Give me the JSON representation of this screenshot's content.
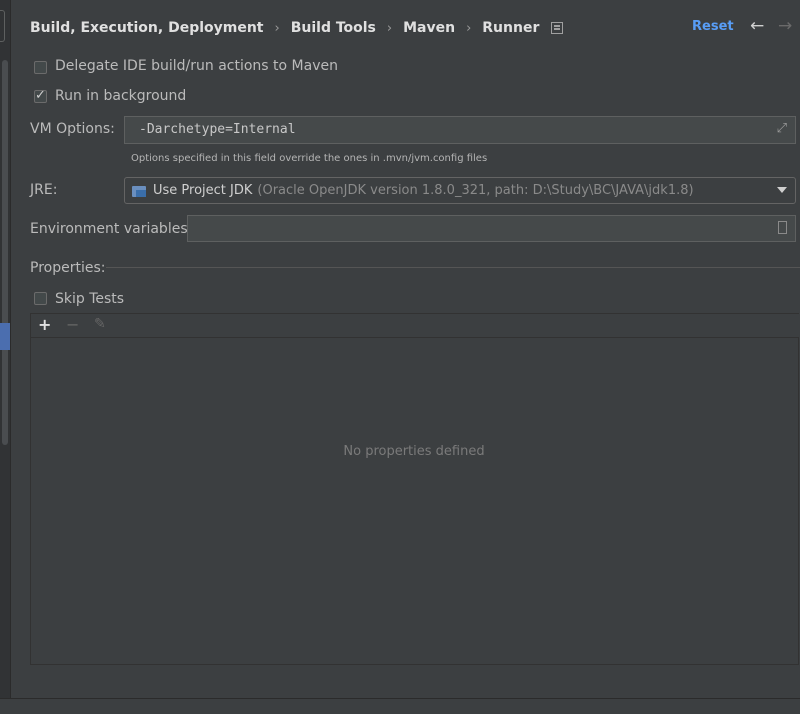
{
  "breadcrumb": {
    "items": [
      "Build, Execution, Deployment",
      "Build Tools",
      "Maven",
      "Runner"
    ],
    "separator": "›"
  },
  "header": {
    "reset_label": "Reset",
    "back_icon": "arrow-left-icon",
    "forward_icon": "arrow-right-icon"
  },
  "options": {
    "delegate": {
      "label": "Delegate IDE build/run actions to Maven",
      "checked": false
    },
    "background": {
      "label": "Run in background",
      "checked": true
    }
  },
  "vm_options": {
    "label": "VM Options:",
    "value": "-Darchetype=Internal",
    "hint": "Options specified in this field override the ones in .mvn/jvm.config files"
  },
  "jre": {
    "label": "JRE:",
    "selected": "Use Project JDK",
    "detail": "(Oracle OpenJDK version 1.8.0_321, path: D:\\Study\\BC\\JAVA\\jdk1.8)"
  },
  "env": {
    "label": "Environment variables:",
    "value": ""
  },
  "properties": {
    "label": "Properties:",
    "skip_tests": {
      "label": "Skip Tests",
      "checked": false
    },
    "toolbar": {
      "add": "+",
      "remove": "−",
      "edit": "✎"
    },
    "empty_text": "No properties defined"
  },
  "colors": {
    "background": "#3c3f41",
    "link": "#589df6",
    "field": "#45494a"
  }
}
